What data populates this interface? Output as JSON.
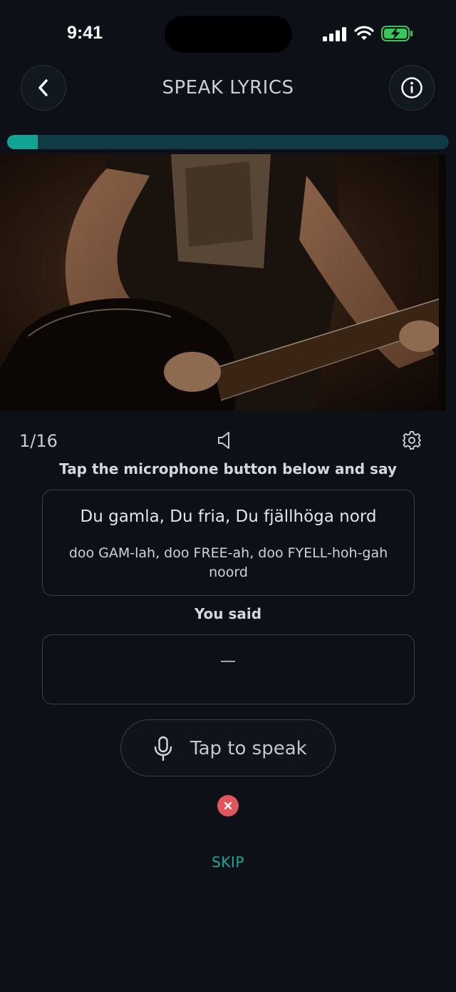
{
  "status_bar": {
    "time": "9:41"
  },
  "header": {
    "title": "SPEAK LYRICS",
    "back_icon": "chevron-left-icon",
    "info_icon": "info-icon"
  },
  "progress": {
    "value": 0.07,
    "color": "#12a394"
  },
  "video": {
    "play_icon": "play-icon"
  },
  "controls": {
    "counter": "1/16",
    "sound_icon": "speaker-icon",
    "settings_icon": "gear-icon"
  },
  "prompt": {
    "instruction": "Tap the microphone button below and say",
    "lyric": "Du gamla, Du fria, Du fjällhöga nord",
    "pronunciation": "doo GAM-lah, doo FREE-ah, doo FYELL-hoh-gah noord"
  },
  "response": {
    "label": "You said",
    "value": "—"
  },
  "speak_button": {
    "label": "Tap to speak",
    "icon": "microphone-icon"
  },
  "close_icon": "close-icon",
  "skip_label": "SKIP",
  "colors": {
    "background": "#0d1117",
    "accent": "#12a394",
    "danger": "#e0565b"
  }
}
